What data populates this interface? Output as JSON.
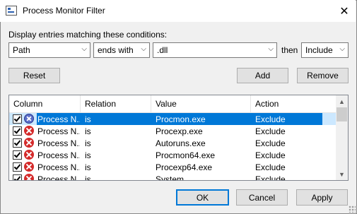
{
  "window": {
    "title": "Process Monitor Filter",
    "close_glyph": "✕"
  },
  "conditions": {
    "label": "Display entries matching these conditions:",
    "column": "Path",
    "relation": "ends with",
    "value": ".dll",
    "then_label": "then",
    "action": "Include",
    "chevron": "⌵"
  },
  "buttons": {
    "reset": "Reset",
    "add": "Add",
    "remove": "Remove",
    "ok": "OK",
    "cancel": "Cancel",
    "apply": "Apply"
  },
  "table": {
    "headers": [
      "Column",
      "Relation",
      "Value",
      "Action"
    ],
    "rows": [
      {
        "column": "Process N...",
        "relation": "is",
        "value": "Procmon.exe",
        "action": "Exclude",
        "checked": true,
        "selected": true
      },
      {
        "column": "Process N...",
        "relation": "is",
        "value": "Procexp.exe",
        "action": "Exclude",
        "checked": true,
        "selected": false
      },
      {
        "column": "Process N...",
        "relation": "is",
        "value": "Autoruns.exe",
        "action": "Exclude",
        "checked": true,
        "selected": false
      },
      {
        "column": "Process N...",
        "relation": "is",
        "value": "Procmon64.exe",
        "action": "Exclude",
        "checked": true,
        "selected": false
      },
      {
        "column": "Process N...",
        "relation": "is",
        "value": "Procexp64.exe",
        "action": "Exclude",
        "checked": true,
        "selected": false
      },
      {
        "column": "Process N...",
        "relation": "is",
        "value": "System",
        "action": "Exclude",
        "checked": true,
        "selected": false
      }
    ],
    "scroll_up": "▲",
    "scroll_down": "▼"
  },
  "colors": {
    "selection": "#0078d7",
    "exclude_icon": "#d42a2a",
    "accent_border": "#0078d7"
  }
}
